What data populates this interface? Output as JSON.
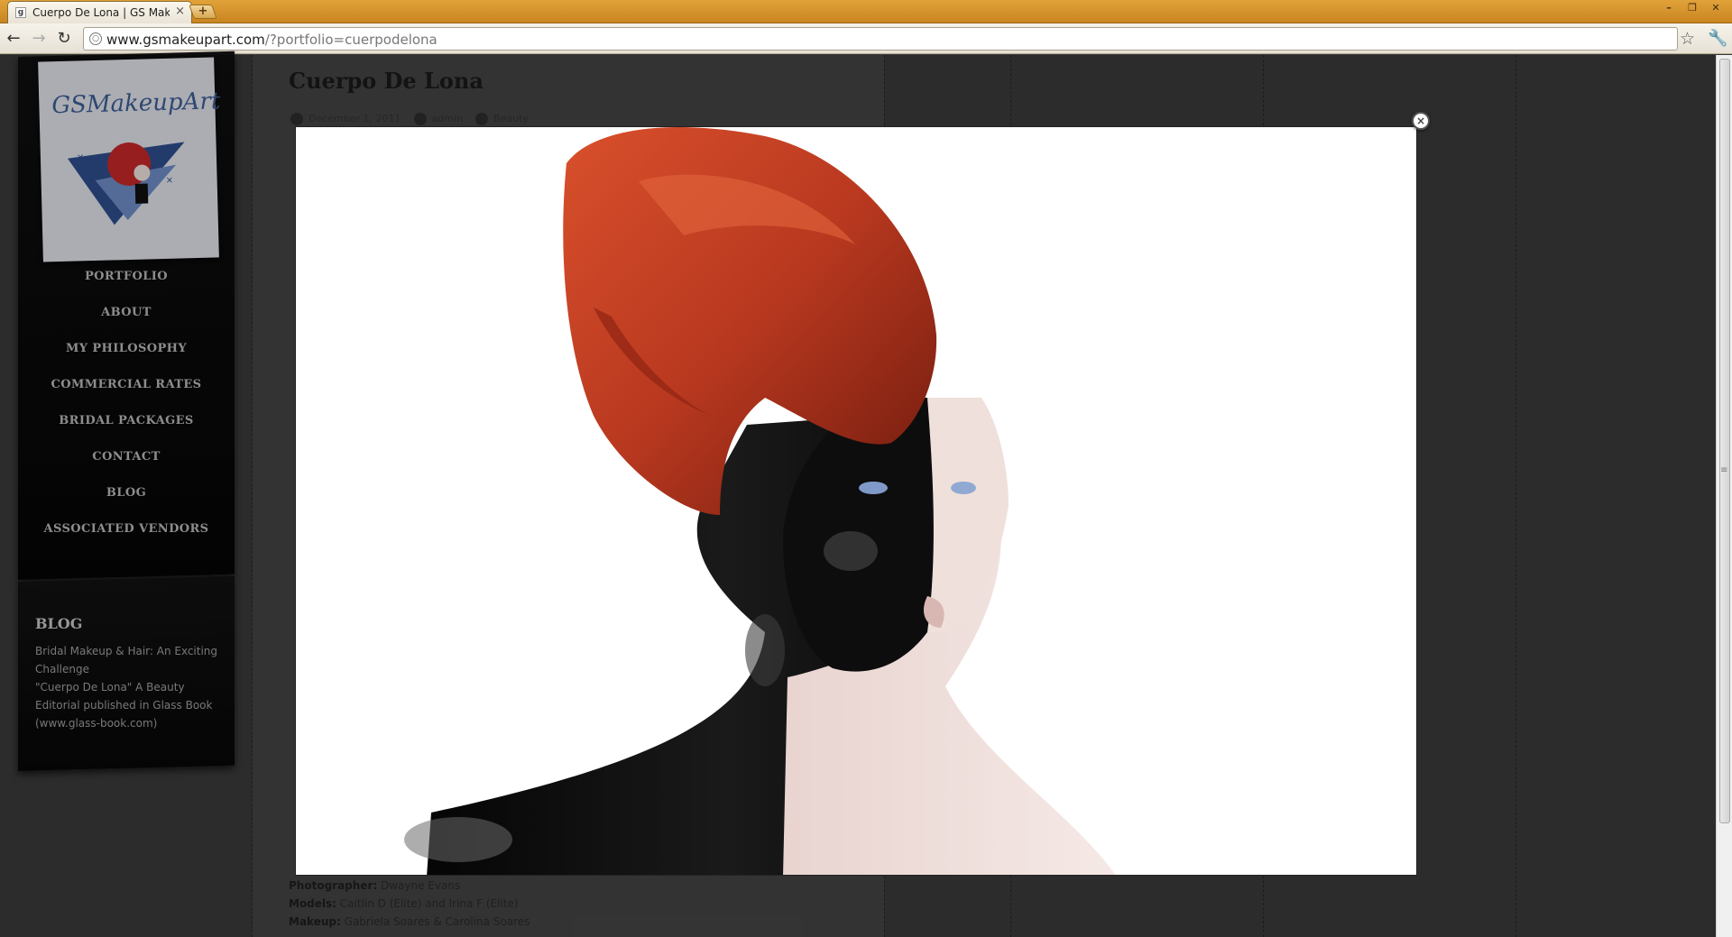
{
  "browser": {
    "tab_title": "Cuerpo De Lona | GS Makeu",
    "tab_close": "×",
    "new_tab": "+",
    "url_host": "www.gsmakeupart.com",
    "url_rest": "/?portfolio=cuerpodelona",
    "window_buttons": [
      "–",
      "❐",
      "✕"
    ]
  },
  "site": {
    "logo_text": "GSMakeupArt",
    "nav": [
      "PORTFOLIO",
      "ABOUT",
      "MY PHILOSOPHY",
      "COMMERCIAL RATES",
      "BRIDAL PACKAGES",
      "CONTACT",
      "BLOG",
      "ASSOCIATED VENDORS"
    ],
    "blog_widget": {
      "title": "BLOG",
      "links": [
        "Bridal Makeup & Hair: An Exciting Challenge",
        "\"Cuerpo De Lona\" A Beauty Editorial published in Glass Book (www.glass-book.com)"
      ]
    }
  },
  "post": {
    "title": "Cuerpo De Lona",
    "meta": [
      "December 1, 2011",
      "admin",
      "Beauty"
    ],
    "credits": [
      {
        "label": "Photographer:",
        "value": "Dwayne Evans"
      },
      {
        "label": "Models:",
        "value": "Caitlin D (Elite) and Irina F (Elite)"
      },
      {
        "label": "Makeup:",
        "value": "Gabriela Soares & Carolina Soares"
      }
    ]
  },
  "lightbox": {
    "close_label": "×"
  },
  "colors": {
    "chrome_accent": "#d9962e",
    "page_bg": "#3b3b3b",
    "hair": "#b8381f",
    "paint": "#0b0b0b"
  }
}
